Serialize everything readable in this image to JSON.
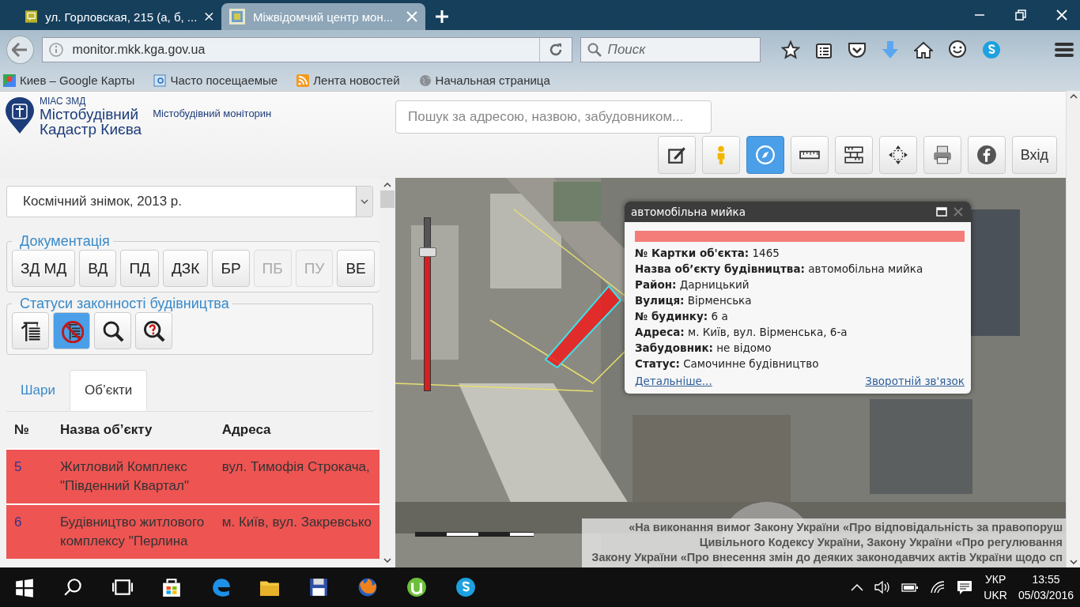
{
  "browser": {
    "tabs": [
      {
        "title": "ул. Горловская, 215 (а, б, ...",
        "selected": false
      },
      {
        "title": "Міжвідомчий центр мон...",
        "selected": true
      }
    ],
    "address": "monitor.mkk.kga.gov.ua",
    "search": {
      "placeholder": "Поиск"
    },
    "bookmarks": [
      {
        "label": "Киев – Google Карты",
        "kind": "maps"
      },
      {
        "label": "Часто посещаемые",
        "kind": "folder"
      },
      {
        "label": "Лента новостей",
        "kind": "rss"
      },
      {
        "label": "Начальная страница",
        "kind": "globe"
      }
    ]
  },
  "header": {
    "logo": {
      "caption": "МІАС ЗМД",
      "line_1": "Містобудівний",
      "line_2": "Кадастр Києва"
    },
    "subtitle": "Містобудівний моніторин",
    "search": {
      "placeholder": "Пошук за адресою, назвою, забудовником..."
    },
    "tools": [
      {
        "kind": "edit",
        "selected": false
      },
      {
        "kind": "person",
        "selected": false
      },
      {
        "kind": "compass",
        "selected": true
      },
      {
        "kind": "ruler",
        "selected": false
      },
      {
        "kind": "area-ruler",
        "selected": false
      },
      {
        "kind": "extent",
        "selected": false
      },
      {
        "kind": "print",
        "selected": false
      },
      {
        "kind": "facebook",
        "selected": false
      }
    ],
    "login_button": "Вхід"
  },
  "left_panel": {
    "basemap_select": "Космічний знімок, 2013 р.",
    "documents": {
      "title": "Документація",
      "buttons": [
        {
          "label": "ЗД МД",
          "disabled": false
        },
        {
          "label": "ВД",
          "disabled": false
        },
        {
          "label": "ПД",
          "disabled": false
        },
        {
          "label": "ДЗК",
          "disabled": false
        },
        {
          "label": "БР",
          "disabled": false
        },
        {
          "label": "ПБ",
          "disabled": true
        },
        {
          "label": "ПУ",
          "disabled": true
        },
        {
          "label": "ВЕ",
          "disabled": false
        }
      ]
    },
    "statuses": {
      "title": "Статуси законності будівництва",
      "buttons": [
        {
          "kind": "crane",
          "selected": false
        },
        {
          "kind": "no-construction",
          "selected": true
        },
        {
          "kind": "search",
          "selected": false
        },
        {
          "kind": "question-search",
          "selected": false
        }
      ]
    },
    "tabs": [
      {
        "label": "Шари",
        "selected": false
      },
      {
        "label": "Об’єкти",
        "selected": true
      }
    ],
    "table": {
      "columns": [
        "№",
        "Назва об’єкту",
        "Адреса"
      ],
      "rows": [
        {
          "number": "5",
          "name": "Житловий Комплекс \"Південний Квартал\"",
          "address": "вул. Тимофія Строкача,",
          "color": "#ee5452"
        },
        {
          "number": "6",
          "name": "Будівництво житлового комплексу \"Перлина",
          "address": "м. Київ, вул. Закревсько",
          "color": "#ee5452"
        }
      ]
    }
  },
  "map": {
    "zoom_slider": {
      "level": 0.8
    },
    "popup": {
      "title": "автомобільна мийка",
      "color": "#f47c79",
      "fields": [
        "**№ Картки об'єкта:** 1465",
        "**Назва об’єкту будівництва:** автомобільна мийка",
        "**Район:** Дарницький",
        "**Вулиця:** Вірменська",
        "**№ будинку:** 6 а",
        "**Адреса:** м. Київ, вул. Вірменська, 6-а",
        "**Забудовник:** не відомо",
        "**Статус:** Самочинне будівництво"
      ],
      "details_link": "Детальніше...",
      "feedback_link": "Зворотній зв'язок"
    },
    "disclaimer": [
      "«На виконання вимог Закону України «Про відповідальність за правопоруш",
      "Цивільного Кодексу України, Закону України «Про регулювання",
      "Закону України «Про внесення змін до деяких законодавчих актів України щодо сп"
    ]
  },
  "taskbar": {
    "apps": [
      {
        "kind": "start"
      },
      {
        "kind": "search"
      },
      {
        "kind": "task-view"
      },
      {
        "kind": "store"
      },
      {
        "kind": "edge"
      },
      {
        "kind": "explorer"
      },
      {
        "kind": "floppy"
      },
      {
        "kind": "firefox"
      },
      {
        "kind": "utorrent"
      },
      {
        "kind": "skype"
      }
    ],
    "language": "УКР",
    "keyboard": "UKR",
    "time": "13:55",
    "date": "05/03/2016"
  }
}
